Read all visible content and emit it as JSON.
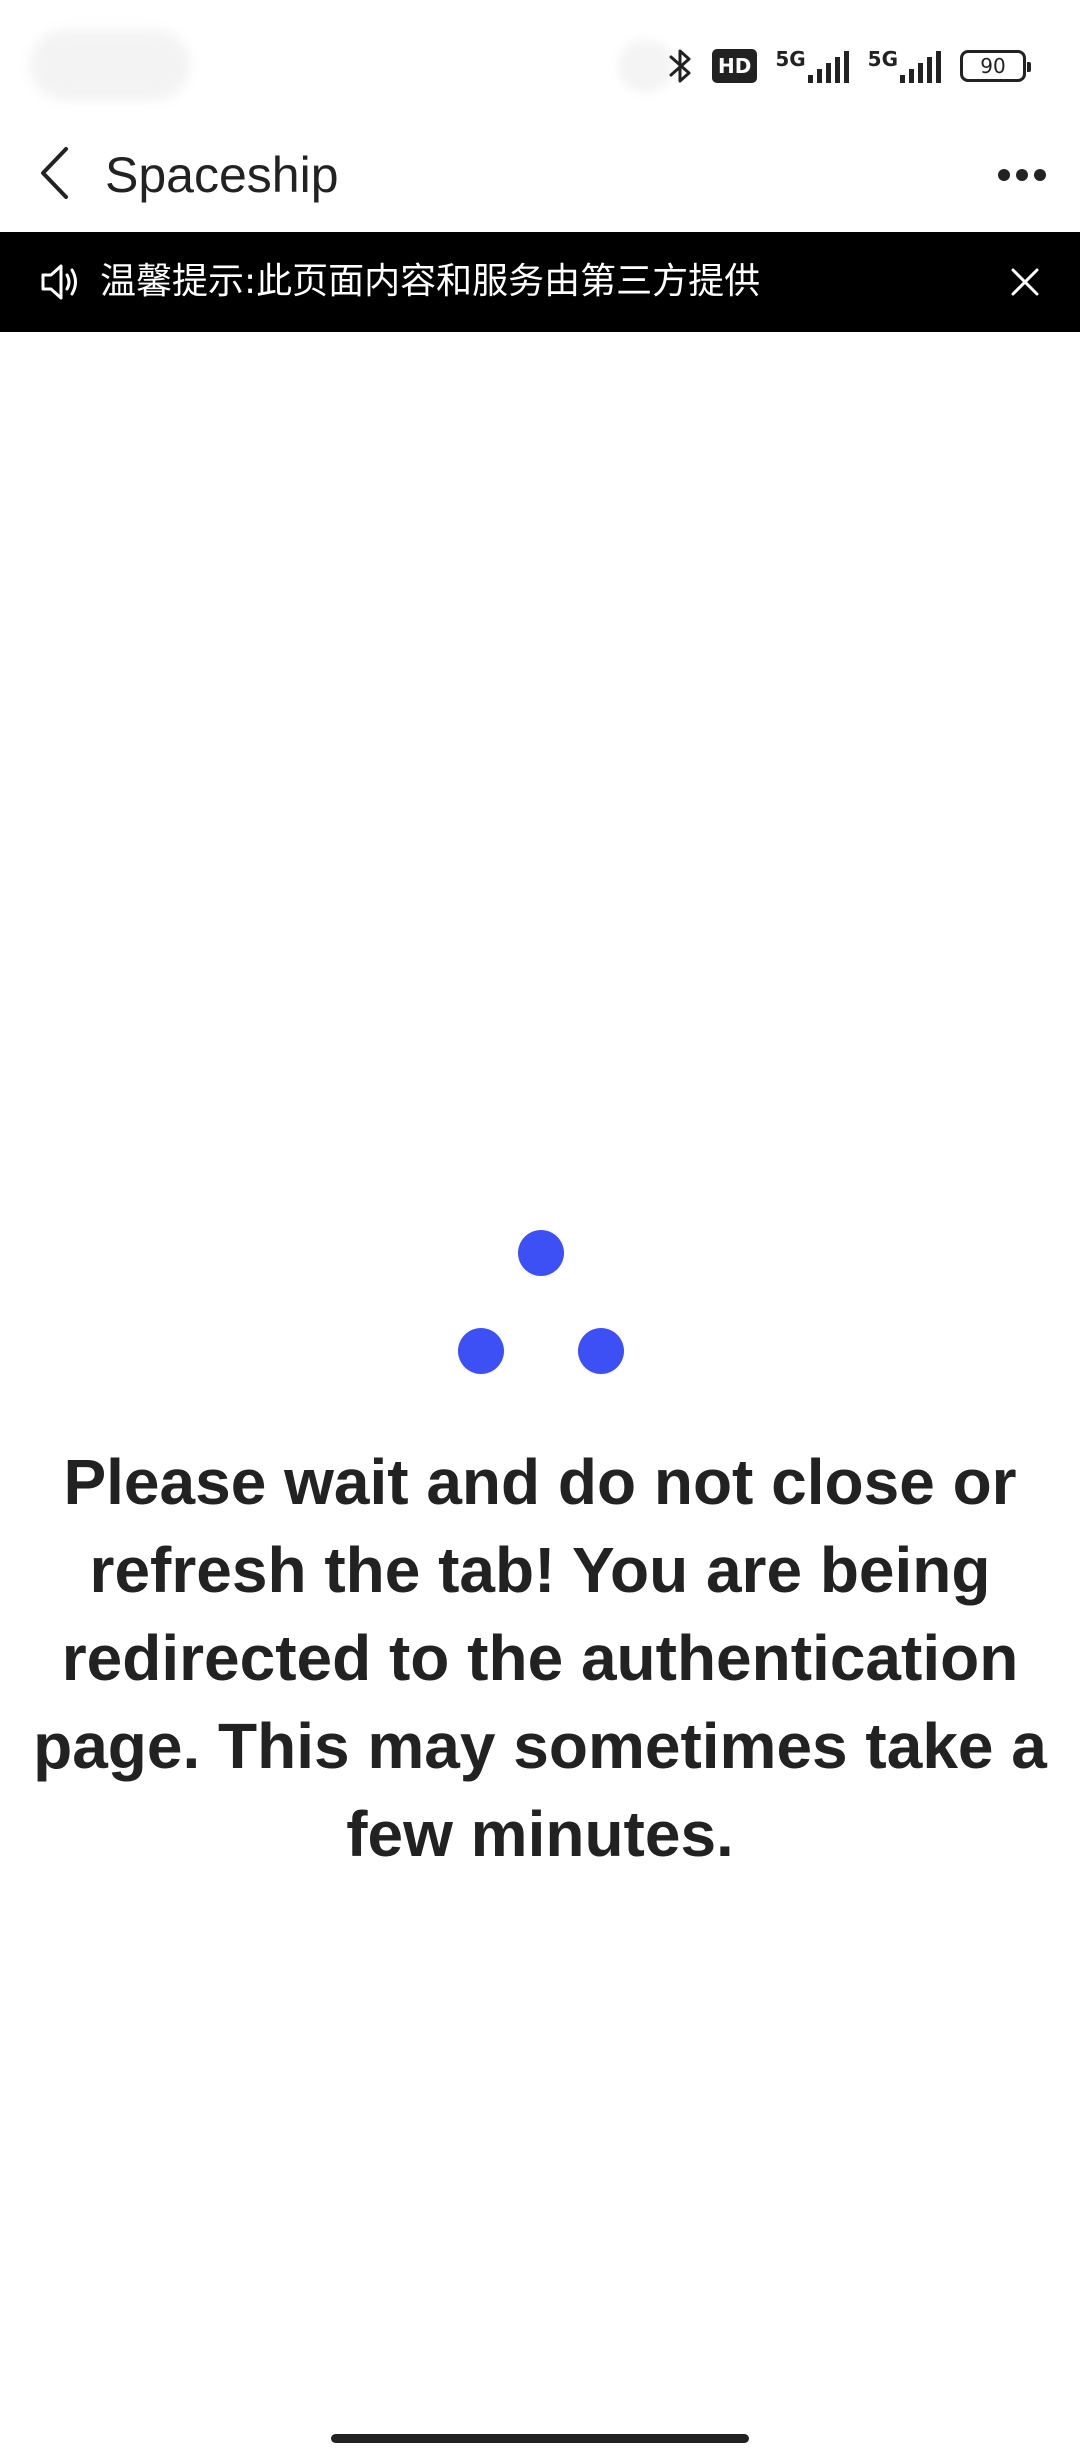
{
  "status_bar": {
    "hd_label": "HD",
    "network_1": "5G",
    "network_2": "5G",
    "battery": "90"
  },
  "header": {
    "title": "Spaceship"
  },
  "notice": {
    "text": "温馨提示:此页面内容和服务由第三方提供"
  },
  "loader": {
    "color": "#3d50f5"
  },
  "main": {
    "message": "Please wait and do not close or refresh the tab! You are being redirected to the authentication page. This may sometimes take a few minutes."
  }
}
